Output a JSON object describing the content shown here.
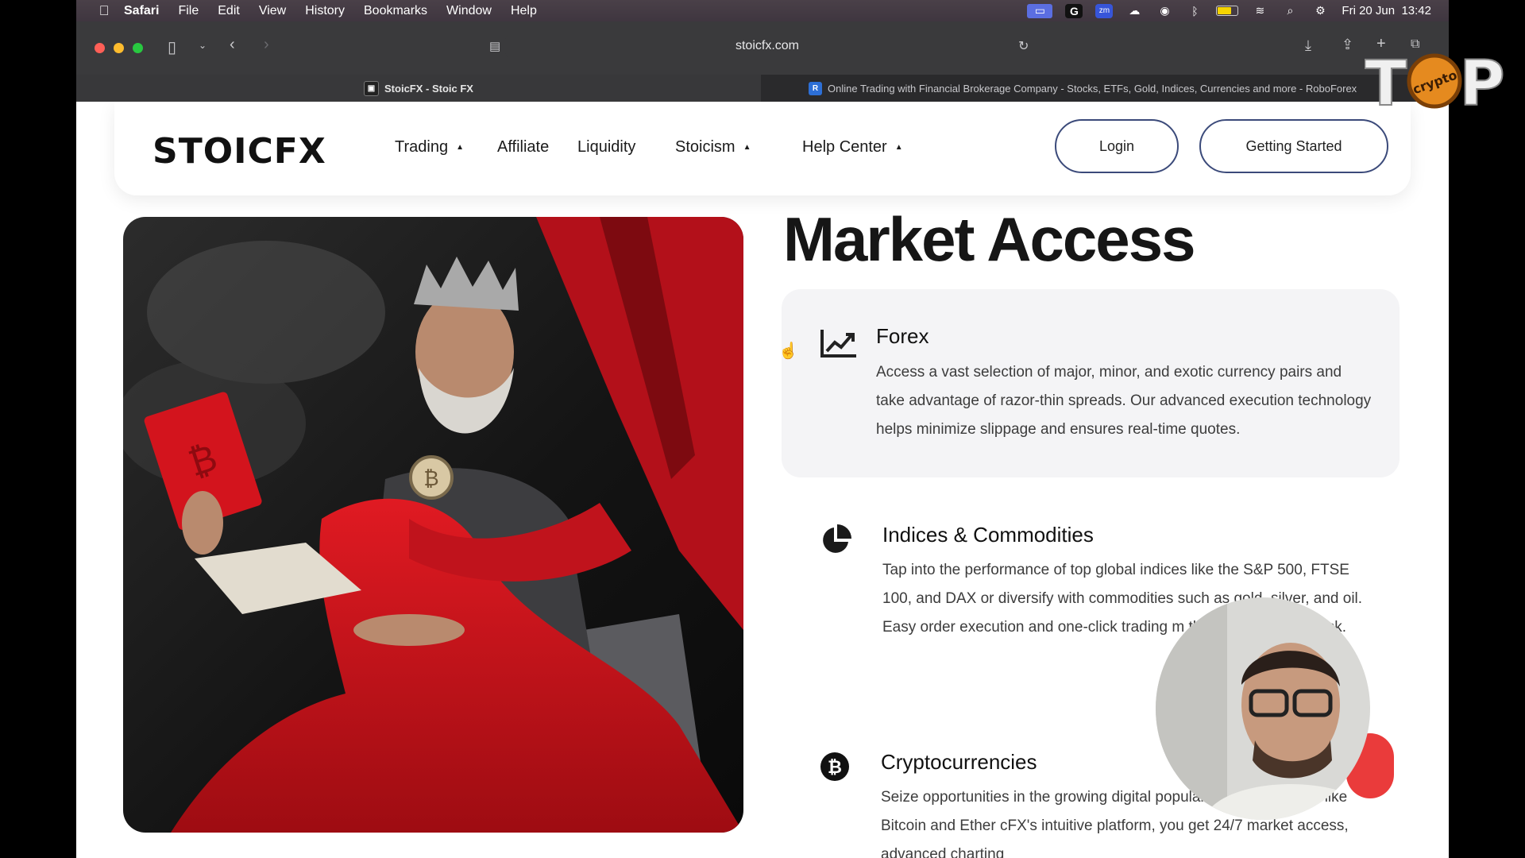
{
  "menubar": {
    "app": "Safari",
    "items": [
      "File",
      "Edit",
      "View",
      "History",
      "Bookmarks",
      "Window",
      "Help"
    ],
    "clock": "Fri 20 Jun  13:42"
  },
  "browser": {
    "url": "stoicfx.com",
    "tabs": [
      {
        "title": "StoicFX - Stoic FX",
        "active": true
      },
      {
        "title": "Online Trading with Financial Brokerage Company - Stocks, ETFs, Gold, Indices, Currencies and more - RoboForex",
        "active": false
      }
    ]
  },
  "site": {
    "logo": "STOICFX",
    "nav": [
      {
        "label": "Trading",
        "dropdown": true
      },
      {
        "label": "Affiliate",
        "dropdown": false
      },
      {
        "label": "Liquidity",
        "dropdown": false
      },
      {
        "label": "Stoicism",
        "dropdown": true
      },
      {
        "label": "Help Center",
        "dropdown": true
      }
    ],
    "login_label": "Login",
    "cta_label": "Getting Started",
    "section_title": "Market Access",
    "features": [
      {
        "title": "Forex",
        "icon": "chart-line-icon",
        "desc": "Access a vast selection of major, minor, and exotic currency pairs and take advantage of razor-thin spreads. Our advanced execution technology helps minimize slippage and ensures real-time quotes."
      },
      {
        "title": "Indices & Commodities",
        "icon": "pie-chart-icon",
        "desc": "Tap into the performance of top global indices like the S&P 500, FTSE 100, and DAX or diversify with commodities such as gold, silver, and oil. Easy order execution and one-click trading m than ever to hedge risk."
      },
      {
        "title": "Cryptocurrencies",
        "icon": "bitcoin-icon",
        "desc": "Seize opportunities in the growing digital popular cryptocurrencies like Bitcoin and Ether cFX's intuitive platform, you get 24/7 market access, advanced charting"
      }
    ]
  },
  "overlay": {
    "badge_text": "TOP",
    "badge_sub": "crypto"
  },
  "colors": {
    "accent_border": "#3b4a7a",
    "red": "#d7141a",
    "fab": "#ea3b3b"
  }
}
